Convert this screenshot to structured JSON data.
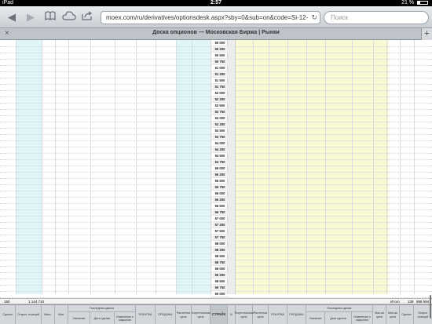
{
  "status_bar": {
    "device": "iPad",
    "time": "2:57",
    "battery": "21 %"
  },
  "toolbar": {
    "back_icon": "back-arrow-icon",
    "forward_icon": "forward-arrow-icon",
    "url": "moex.com/ru/derivatives/optionsdesk.aspx?sby=0&sub=on&code=Si-12-",
    "search_placeholder": "Поиск"
  },
  "tab": {
    "title": "Доска опционов — Московская Биржа | Рынки"
  },
  "strikes": [
    "50 000",
    "50 250",
    "50 500",
    "50 750",
    "51 000",
    "51 250",
    "51 500",
    "51 750",
    "52 000",
    "52 250",
    "52 500",
    "52 750",
    "53 000",
    "53 250",
    "53 500",
    "53 750",
    "54 000",
    "54 250",
    "54 500",
    "54 750",
    "55 000",
    "55 250",
    "55 500",
    "55 750",
    "56 000",
    "56 250",
    "56 500",
    "56 750",
    "57 000",
    "57 250",
    "57 500",
    "57 750",
    "58 000",
    "58 250",
    "58 500",
    "58 750",
    "59 000",
    "59 250",
    "59 500",
    "59 750",
    "60 000"
  ],
  "totals": {
    "left_deals": "150",
    "left_oi": "1 144 710",
    "right_label": "Итого",
    "right_deals": "139",
    "right_oi": "888 594"
  },
  "header": {
    "calls": {
      "deals": "Сделки",
      "oi": "Открыт. позиций",
      "max": "Макс.",
      "min": "Мин.",
      "last_deal_group": "Последняя сделка",
      "value": "Значение",
      "date": "Дата сделки",
      "change": "Изменение к закрытию",
      "buy": "ПОКУПКА",
      "sell": "ПРОДАЖА",
      "calc_price": "Расчетная цена",
      "theor_price": "Теоретическая цена"
    },
    "strike": "СТРАЙК",
    "iv": "IV",
    "puts": {
      "theor_price": "Теоретическая цена",
      "calc_price": "Расчетная цена",
      "buy": "ПОКУПКА",
      "sell": "ПРОДАЖА",
      "last_deal_group": "Последняя сделка",
      "value": "Значение",
      "date": "Дата сделки",
      "change": "Изменение к закрытию",
      "max": "Мак-ая цена",
      "min": "Мин-ая цена",
      "deals": "Сделки",
      "oi": "Открыт. позиций"
    }
  }
}
